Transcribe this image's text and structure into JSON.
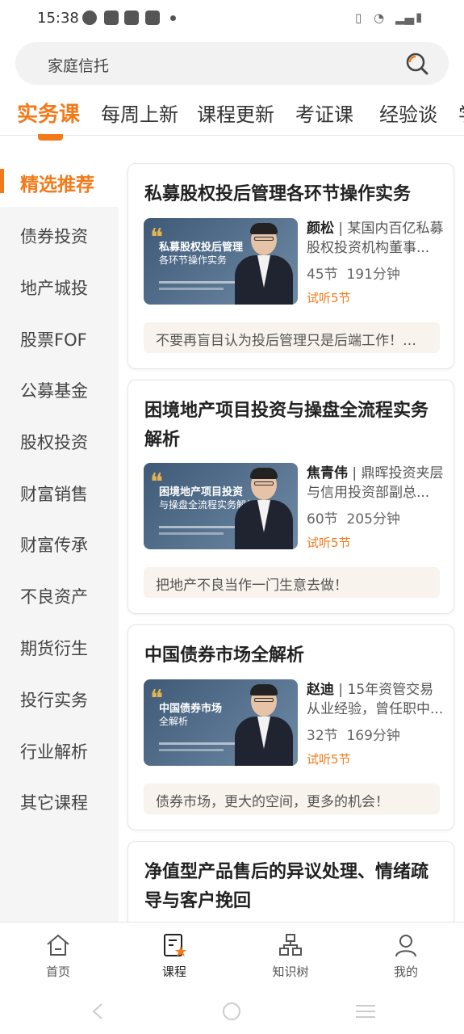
{
  "status": {
    "time": "15:38"
  },
  "search": {
    "query": "家庭信托"
  },
  "tabs": [
    {
      "label": "实务课",
      "active": true
    },
    {
      "label": "每周上新"
    },
    {
      "label": "课程更新"
    },
    {
      "label": "考证课"
    },
    {
      "label": "经验谈"
    },
    {
      "label": "学"
    }
  ],
  "sidebar": [
    {
      "label": "精选推荐",
      "active": true
    },
    {
      "label": "债券投资"
    },
    {
      "label": "地产城投"
    },
    {
      "label": "股票FOF"
    },
    {
      "label": "公募基金"
    },
    {
      "label": "股权投资"
    },
    {
      "label": "财富销售"
    },
    {
      "label": "财富传承"
    },
    {
      "label": "不良资产"
    },
    {
      "label": "期货衍生"
    },
    {
      "label": "投行实务"
    },
    {
      "label": "行业解析"
    },
    {
      "label": "其它课程"
    }
  ],
  "courses": [
    {
      "title": "私募股权投后管理各环节操作实务",
      "thumb_line1": "私募股权投后管理",
      "thumb_line2": "各环节操作实务",
      "teacher": "颜松",
      "teacher_desc": "某国内百亿私募股权投资机构董事...",
      "lessons": "45节",
      "duration": "191分钟",
      "trial": "试听5节",
      "quote": "不要再盲目认为投后管理只是后端工作！实..."
    },
    {
      "title": "困境地产项目投资与操盘全流程实务解析",
      "thumb_line1": "困境地产项目投资",
      "thumb_line2": "与操盘全流程实务解析",
      "teacher": "焦青伟",
      "teacher_desc": "鼎晖投资夹层与信用投资部副总...",
      "lessons": "60节",
      "duration": "205分钟",
      "trial": "试听5节",
      "quote": "把地产不良当作一门生意去做！"
    },
    {
      "title": "中国债券市场全解析",
      "thumb_line1": "中国债券市场",
      "thumb_line2": "全解析",
      "teacher": "赵迪",
      "teacher_desc": "15年资管交易从业经验，曾任职中...",
      "lessons": "32节",
      "duration": "169分钟",
      "trial": "试听5节",
      "quote": "债券市场，更大的空间，更多的机会！"
    },
    {
      "title": "净值型产品售后的异议处理、情绪疏导与客户挽回"
    }
  ],
  "bottom_nav": [
    {
      "label": "首页",
      "icon": "home-icon"
    },
    {
      "label": "课程",
      "icon": "course-icon",
      "active": true
    },
    {
      "label": "知识树",
      "icon": "tree-icon"
    },
    {
      "label": "我的",
      "icon": "profile-icon"
    }
  ],
  "colors": {
    "accent": "#f27a1a"
  }
}
